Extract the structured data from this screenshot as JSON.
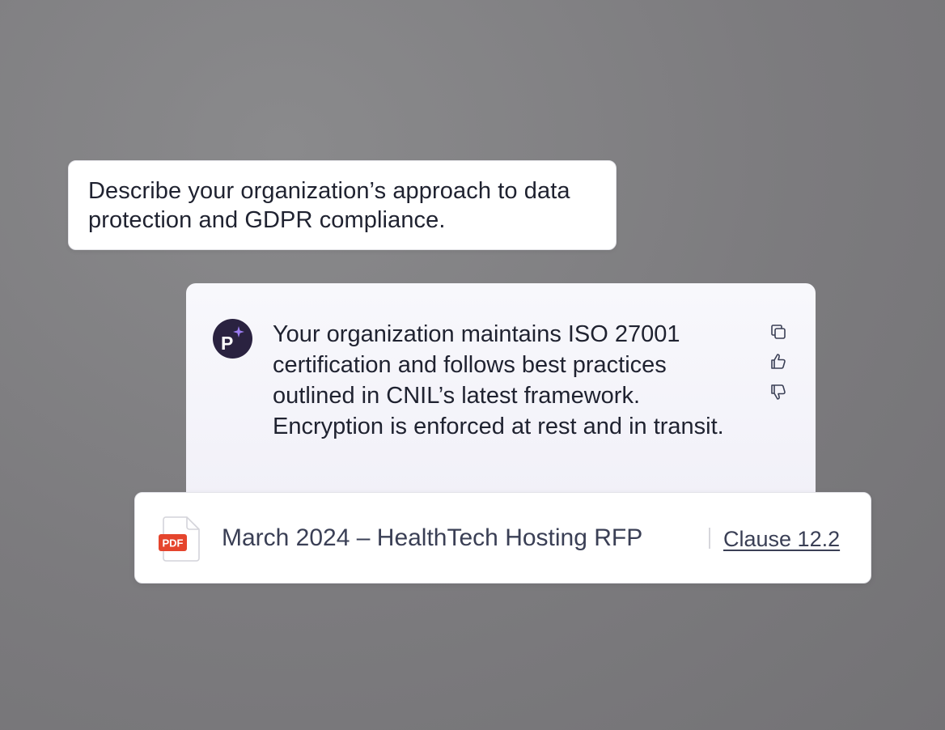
{
  "question": {
    "text": "Describe your organization’s approach to data protection and GDPR compliance."
  },
  "answer": {
    "avatar_letter": "P",
    "avatar_icon": "sparkle-icon",
    "text": "Your organization maintains ISO 27001 certification and follows best practices outlined in CNIL’s latest framework. Encryption is enforced at rest and in transit.",
    "actions": [
      {
        "icon": "copy-icon"
      },
      {
        "icon": "thumbs-up-icon"
      },
      {
        "icon": "thumbs-down-icon"
      }
    ]
  },
  "source": {
    "file_type": "PDF",
    "title": "March 2024 – HealthTech Hosting RFP",
    "clause_label": "Clause 12.2"
  },
  "colors": {
    "avatar_bg": "#2a2240",
    "sparkle": "#9b7cf0",
    "pdf_badge": "#e5452d",
    "text_primary": "#1f2230",
    "text_secondary": "#3a3f55"
  }
}
